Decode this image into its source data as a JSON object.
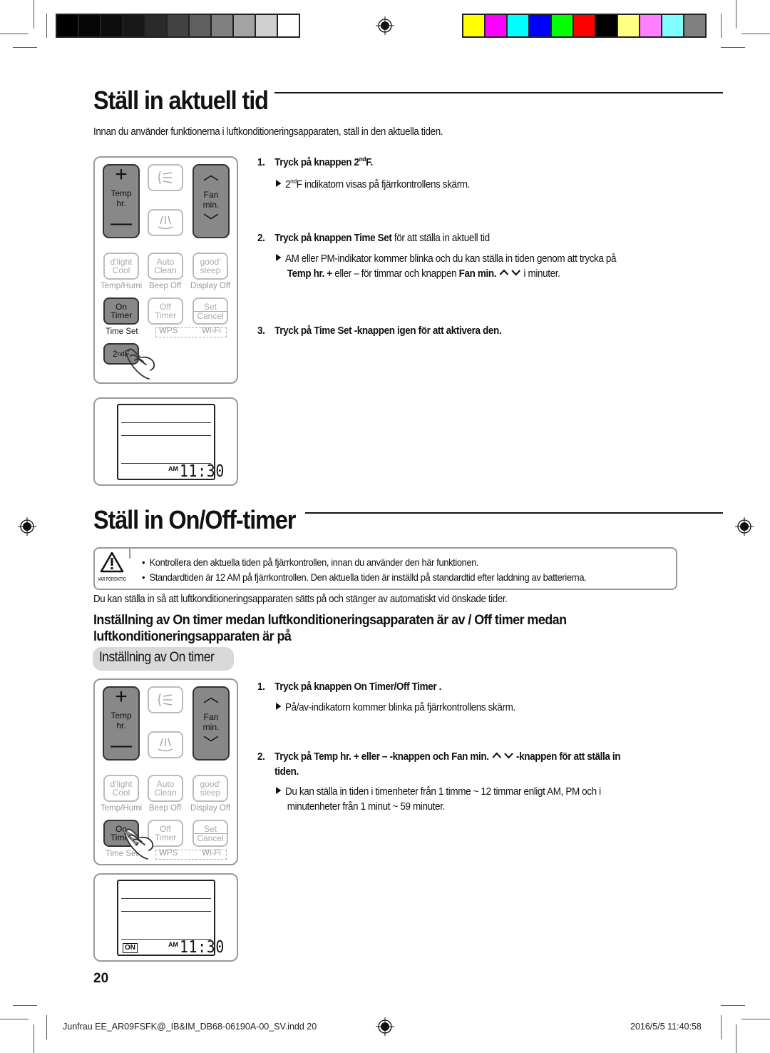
{
  "printer_marks": {
    "gray_swatches": [
      "#000000",
      "#060606",
      "#0d0d0d",
      "#181818",
      "#2a2a2a",
      "#434343",
      "#5f5f5f",
      "#808080",
      "#a3a3a3",
      "#d0d0d0",
      "#ffffff"
    ],
    "color_swatches": [
      "#ffff00",
      "#ff00ff",
      "#00ffff",
      "#0000ff",
      "#00ff00",
      "#ff0000",
      "#000000",
      "#ffff80",
      "#ff80ff",
      "#80ffff",
      "#808080"
    ]
  },
  "section1": {
    "title": "Ställ in aktuell tid",
    "intro": "Innan du använder funktionerna i luftkonditioneringsapparaten, ställ in den aktuella tiden.",
    "steps": [
      {
        "num": "1.",
        "label_prefix": "Tryck på knappen 2",
        "label_sup": "nd",
        "label_suffix": "F.",
        "detail_prefix": "2",
        "detail_sup": "nd",
        "detail_suffix": "F indikatorn visas på fjärrkontrollens skärm."
      },
      {
        "num": "2.",
        "label_a": "Tryck på knappen ",
        "label_b": "Time Set",
        "label_c": " för att ställa in aktuell tid",
        "detail_line1": "AM eller PM-indikator kommer blinka och du kan ställa in tiden genom att trycka på",
        "detail_line2_a": "Temp hr. +",
        "detail_line2_b": " eller – för timmar och knappen ",
        "detail_line2_c": "Fan min.",
        "detail_line2_d": " i minuter."
      },
      {
        "num": "3.",
        "label_a": "Tryck på ",
        "label_b": "Time Set",
        "label_c": " -knappen igen för att aktivera den."
      }
    ]
  },
  "remote": {
    "temp_label": [
      "Temp",
      "hr."
    ],
    "fan_label": [
      "Fan",
      "min."
    ],
    "plus": "+",
    "minus": "—",
    "up": "︿",
    "down": "﹀",
    "row3": [
      {
        "lines": [
          "d'light",
          "Cool"
        ],
        "sub": "Temp/Humi"
      },
      {
        "lines": [
          "Auto",
          "Clean"
        ],
        "sub": "Beep Off"
      },
      {
        "lines": [
          "good'",
          "sleep"
        ],
        "sub": "Display Off"
      }
    ],
    "row4": [
      {
        "lines": [
          "On",
          "Timer"
        ],
        "sub": "Time Set"
      },
      {
        "lines": [
          "Off",
          "Timer"
        ],
        "sub": "WPS"
      },
      {
        "lines": [
          "Set",
          "Cancel"
        ],
        "sub": "Wi-Fi"
      }
    ],
    "second_f": {
      "prefix": "2",
      "sup": "nd",
      "suffix": " F"
    }
  },
  "display1": {
    "am": "AM",
    "time": "11:30"
  },
  "section2": {
    "title": "Ställ in On/Off-timer",
    "caution_label": "VAR FÖRSIKTIG",
    "caution_items": [
      "Kontrollera den aktuella tiden på fjärrkontrollen, innan du använder den här funktionen.",
      "Standardtiden är 12 AM på fjärrkontrollen.  Den aktuella tiden är inställd på standardtid efter laddning av batterierna."
    ],
    "intro": "Du kan ställa in så att luftkonditioneringsapparaten sätts på och stänger av automatiskt vid önskade tider.",
    "subheading_line1": "Inställning av On timer medan luftkonditioneringsapparaten är av / Off timer medan",
    "subheading_line2": "luftkonditioneringsapparaten är på",
    "pill": "Inställning av On timer",
    "steps": [
      {
        "num": "1.",
        "label_a": "Tryck på knappen ",
        "label_b": "On Timer/Off Timer",
        "label_c": " .",
        "detail": "På/av-indikatorn kommer blinka på fjärrkontrollens skärm."
      },
      {
        "num": "2.",
        "label_a": "Tryck på ",
        "label_b": "Temp hr.",
        "label_c": " + eller – -knappen och ",
        "label_d": "Fan min.",
        "label_e": " -knappen för att ställa in",
        "label_line2": "tiden.",
        "detail_line1": "Du kan ställa in tiden i timenheter från 1 timme ~ 12 timmar enligt AM, PM och i",
        "detail_line2": "minutenheter från 1 minut ~ 59 minuter."
      }
    ]
  },
  "display2": {
    "on_badge": "ON",
    "am": "AM",
    "time": "11:30"
  },
  "page_number": "20",
  "footer": {
    "file": "Junfrau EE_AR09FSFK@_IB&IM_DB68-06190A-00_SV.indd   20",
    "timestamp": "2016/5/5   11:40:58"
  }
}
